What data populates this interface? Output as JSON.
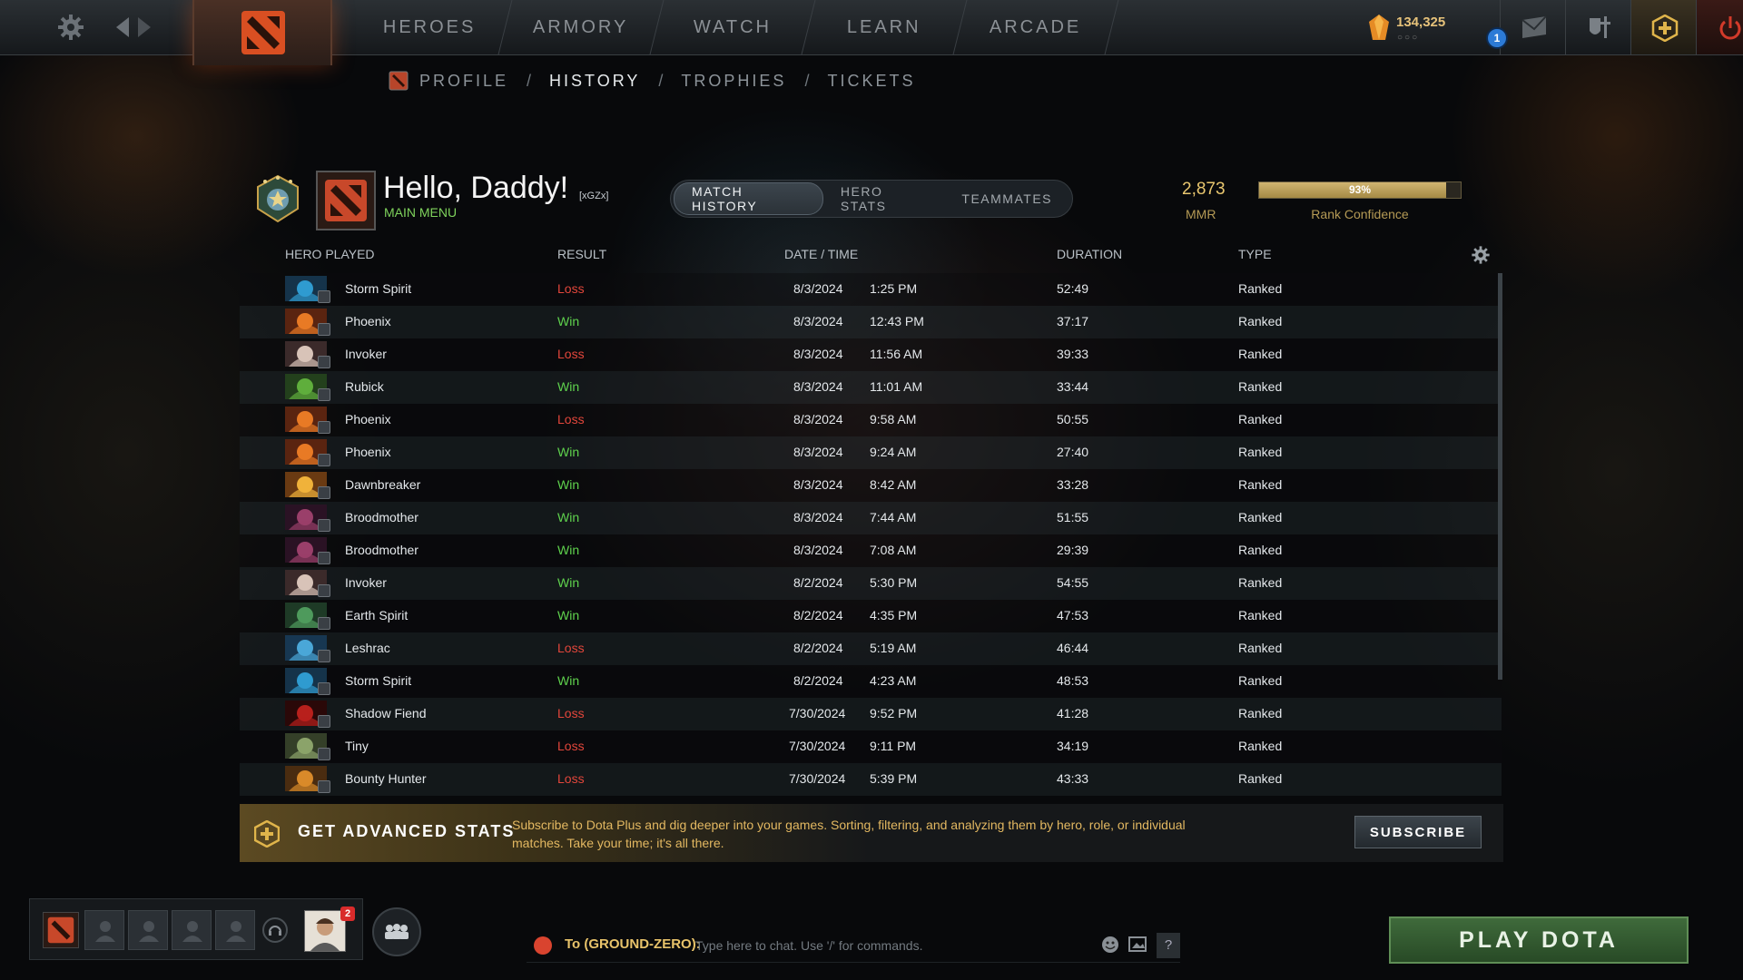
{
  "colors": {
    "win": "#5fd24d",
    "loss": "#e2463b",
    "gold": "#e9c76f",
    "plus": "#e3b861",
    "play": "#3f6a3b"
  },
  "topnav": {
    "items": [
      "HEROES",
      "ARMORY",
      "WATCH",
      "LEARN",
      "ARCADE"
    ],
    "gold_amount": "134,325",
    "gold_dots": "○○○",
    "notification_count": "1"
  },
  "subnav": {
    "items": [
      "PROFILE",
      "HISTORY",
      "TROPHIES",
      "TICKETS"
    ],
    "separator": "/",
    "active_index": 1
  },
  "profile": {
    "name": "Hello, Daddy!",
    "tag": "[xGZx]",
    "status": "MAIN MENU",
    "tabs": [
      "MATCH HISTORY",
      "HERO STATS",
      "TEAMMATES"
    ],
    "active_tab": 0,
    "mmr_value": "2,873",
    "mmr_label": "MMR",
    "rank_confidence": 93,
    "rank_confidence_text": "93%",
    "rank_confidence_label": "Rank Confidence"
  },
  "table": {
    "headers": [
      "HERO PLAYED",
      "RESULT",
      "DATE / TIME",
      "DURATION",
      "TYPE"
    ],
    "rows": [
      {
        "hero": "Storm Spirit",
        "result": "Loss",
        "date": "8/3/2024",
        "time": "1:25 PM",
        "duration": "52:49",
        "type": "Ranked",
        "c1": "#2f9bd0",
        "c2": "#15334a"
      },
      {
        "hero": "Phoenix",
        "result": "Win",
        "date": "8/3/2024",
        "time": "12:43 PM",
        "duration": "37:17",
        "type": "Ranked",
        "c1": "#e87a25",
        "c2": "#5a2410"
      },
      {
        "hero": "Invoker",
        "result": "Loss",
        "date": "8/3/2024",
        "time": "11:56 AM",
        "duration": "39:33",
        "type": "Ranked",
        "c1": "#d8c3b8",
        "c2": "#3b2a2a"
      },
      {
        "hero": "Rubick",
        "result": "Win",
        "date": "8/3/2024",
        "time": "11:01 AM",
        "duration": "33:44",
        "type": "Ranked",
        "c1": "#5fae3c",
        "c2": "#23401c"
      },
      {
        "hero": "Phoenix",
        "result": "Loss",
        "date": "8/3/2024",
        "time": "9:58 AM",
        "duration": "50:55",
        "type": "Ranked",
        "c1": "#e87a25",
        "c2": "#5a2410"
      },
      {
        "hero": "Phoenix",
        "result": "Win",
        "date": "8/3/2024",
        "time": "9:24 AM",
        "duration": "27:40",
        "type": "Ranked",
        "c1": "#e87a25",
        "c2": "#5a2410"
      },
      {
        "hero": "Dawnbreaker",
        "result": "Win",
        "date": "8/3/2024",
        "time": "8:42 AM",
        "duration": "33:28",
        "type": "Ranked",
        "c1": "#f0b23a",
        "c2": "#6a3a12"
      },
      {
        "hero": "Broodmother",
        "result": "Win",
        "date": "8/3/2024",
        "time": "7:44 AM",
        "duration": "51:55",
        "type": "Ranked",
        "c1": "#9a3f6a",
        "c2": "#2a1224"
      },
      {
        "hero": "Broodmother",
        "result": "Win",
        "date": "8/3/2024",
        "time": "7:08 AM",
        "duration": "29:39",
        "type": "Ranked",
        "c1": "#9a3f6a",
        "c2": "#2a1224"
      },
      {
        "hero": "Invoker",
        "result": "Win",
        "date": "8/2/2024",
        "time": "5:30 PM",
        "duration": "54:55",
        "type": "Ranked",
        "c1": "#d8c3b8",
        "c2": "#3b2a2a"
      },
      {
        "hero": "Earth Spirit",
        "result": "Win",
        "date": "8/2/2024",
        "time": "4:35 PM",
        "duration": "47:53",
        "type": "Ranked",
        "c1": "#4e9a5c",
        "c2": "#1e3a26"
      },
      {
        "hero": "Leshrac",
        "result": "Loss",
        "date": "8/2/2024",
        "time": "5:19 AM",
        "duration": "46:44",
        "type": "Ranked",
        "c1": "#4aa7d8",
        "c2": "#173752"
      },
      {
        "hero": "Storm Spirit",
        "result": "Win",
        "date": "8/2/2024",
        "time": "4:23 AM",
        "duration": "48:53",
        "type": "Ranked",
        "c1": "#2f9bd0",
        "c2": "#15334a"
      },
      {
        "hero": "Shadow Fiend",
        "result": "Loss",
        "date": "7/30/2024",
        "time": "9:52 PM",
        "duration": "41:28",
        "type": "Ranked",
        "c1": "#b8201c",
        "c2": "#2a0808"
      },
      {
        "hero": "Tiny",
        "result": "Loss",
        "date": "7/30/2024",
        "time": "9:11 PM",
        "duration": "34:19",
        "type": "Ranked",
        "c1": "#8ba36a",
        "c2": "#343f28"
      },
      {
        "hero": "Bounty Hunter",
        "result": "Loss",
        "date": "7/30/2024",
        "time": "5:39 PM",
        "duration": "43:33",
        "type": "Ranked",
        "c1": "#d98a2a",
        "c2": "#4a2c10"
      }
    ]
  },
  "plus_banner": {
    "title": "GET ADVANCED STATS",
    "description": "Subscribe to Dota Plus and dig deeper into your games. Sorting, filtering, and analyzing them by hero, role, or individual matches. Take your time; it's all there.",
    "button": "SUBSCRIBE"
  },
  "bottom": {
    "friend_badge": "2",
    "chat_channel": "To (GROUND-ZERO):",
    "chat_placeholder": "Type here to chat. Use '/' for commands.",
    "help": "?",
    "play_button": "PLAY DOTA"
  }
}
